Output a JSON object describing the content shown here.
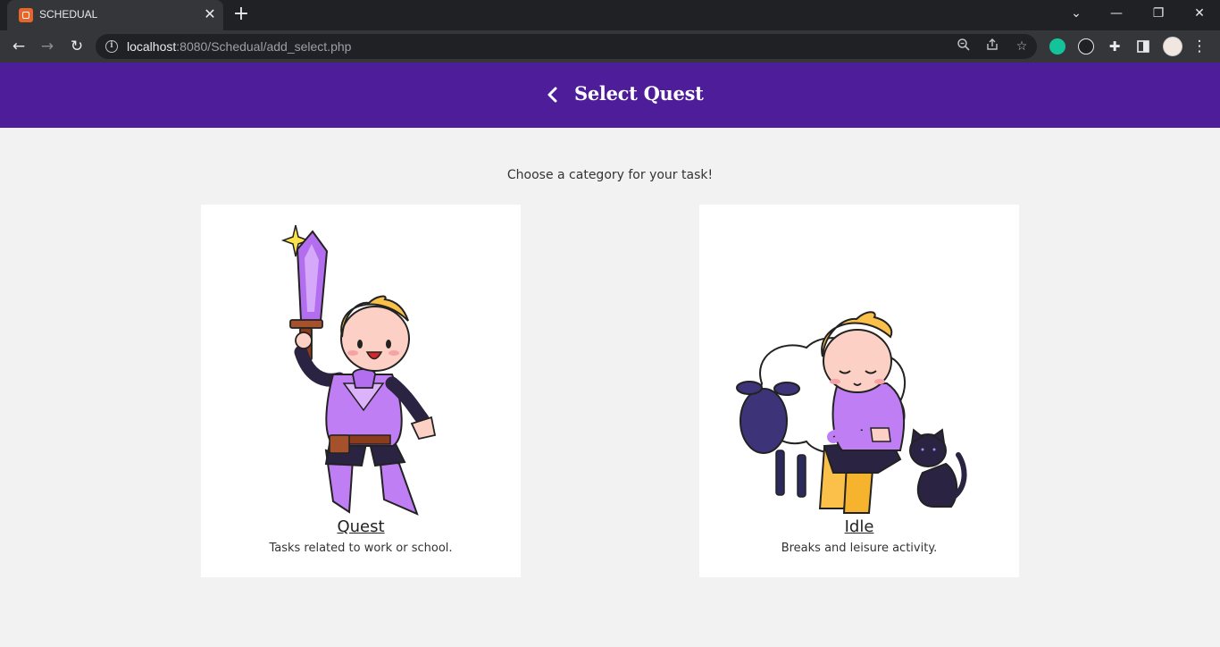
{
  "browser": {
    "tab_title": "SCHEDUAL",
    "url_host": "localhost",
    "url_rest": ":8080/Schedual/add_select.php"
  },
  "header": {
    "title": "Select Quest",
    "background": "#4e1d9a"
  },
  "main": {
    "instruction": "Choose a category for your task!",
    "cards": [
      {
        "title": "Quest",
        "description": "Tasks related to work or school.",
        "illustration": "knight-with-sword"
      },
      {
        "title": "Idle",
        "description": "Breaks and leisure activity.",
        "illustration": "resting-with-sheep-and-cat"
      }
    ]
  },
  "colors": {
    "accent": "#4e1d9a",
    "page_bg": "#f2f2f2",
    "card_bg": "#ffffff"
  }
}
